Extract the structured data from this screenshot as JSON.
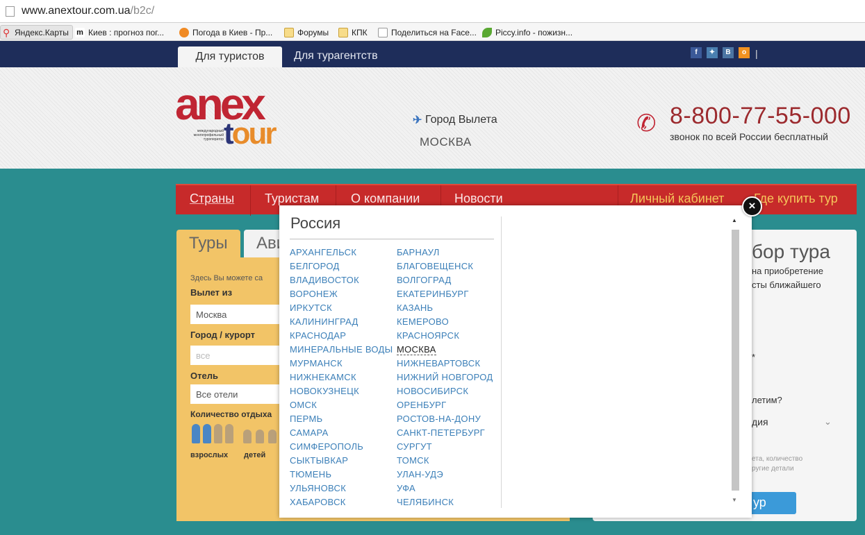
{
  "browser": {
    "url_host": "www.anextour.com.ua",
    "url_path": "/b2c/",
    "bookmarks": [
      {
        "label": "Яндекс.Карты",
        "icon": "yandex-maps-icon"
      },
      {
        "label": "Киев : прогноз пог...",
        "icon": "meteo-icon"
      },
      {
        "label": "Погода в Киев - Пр...",
        "icon": "weather-icon"
      },
      {
        "label": "Форумы",
        "icon": "folder-icon"
      },
      {
        "label": "КПК",
        "icon": "folder-icon"
      },
      {
        "label": "Поделиться на Face...",
        "icon": "page-icon"
      },
      {
        "label": "Piccy.info - пожизн...",
        "icon": "leaf-icon"
      }
    ]
  },
  "topnav": {
    "tab_tourists": "Для туристов",
    "tab_agents": "Для турагентств",
    "social": [
      "f",
      "✦",
      "В",
      "о"
    ],
    "separator": "|"
  },
  "header": {
    "logo_main": "anex",
    "logo_sub_a": "t",
    "logo_sub_b": "our",
    "logo_tagline": "международный многопрофильный туроператор",
    "city_label": "Город Вылета",
    "city_value": "МОСКВА",
    "phone": "8-800-77-55-000",
    "phone_note": "звонок по всей России бесплатный"
  },
  "menu": {
    "items": [
      "Страны",
      "Туристам",
      "О компании",
      "Новости"
    ],
    "cabinet": "Личный кабинет",
    "where_buy": "Где купить тур"
  },
  "left_panel": {
    "tab_tours": "Туры",
    "tab_avia": "Ави",
    "intro": "Здесь Вы можете са",
    "from_label": "Вылет из",
    "from_value": "Москва",
    "city_label": "Город / курорт",
    "city_value": "все",
    "hotel_label": "Отель",
    "hotel_value": "Все отели",
    "count_label": "Количество отдыха",
    "adults_label": "взрослых",
    "children_label": "детей"
  },
  "right_panel": {
    "title": "бор тура",
    "line1": "на приобретение",
    "line2": "сты ближайшего",
    "star": "*",
    "question": "летим?",
    "select_value": "дия",
    "note1": "ета, количество",
    "note2": "ругие детали",
    "button": "ур"
  },
  "overlay": {
    "country": "Россия",
    "selected_city": "МОСКВА",
    "cities_left": [
      "АРХАНГЕЛЬСК",
      "БЕЛГОРОД",
      "ВЛАДИВОСТОК",
      "ВОРОНЕЖ",
      "ИРКУТСК",
      "КАЛИНИНГРАД",
      "КРАСНОДАР",
      "МИНЕРАЛЬНЫЕ ВОДЫ",
      "МУРМАНСК",
      "НИЖНЕКАМСК",
      "НОВОКУЗНЕЦК",
      "ОМСК",
      "ПЕРМЬ",
      "САМАРА",
      "СИМФЕРОПОЛЬ",
      "СЫКТЫВКАР",
      "ТЮМЕНЬ",
      "УЛЬЯНОВСК",
      "ХАБАРОВСК"
    ],
    "cities_right": [
      "БАРНАУЛ",
      "БЛАГОВЕЩЕНСК",
      "ВОЛГОГРАД",
      "ЕКАТЕРИНБУРГ",
      "КАЗАНЬ",
      "КЕМЕРОВО",
      "КРАСНОЯРСК",
      "МОСКВА",
      "НИЖНЕВАРТОВСК",
      "НИЖНИЙ НОВГОРОД",
      "НОВОСИБИРСК",
      "ОРЕНБУРГ",
      "РОСТОВ-НА-ДОНУ",
      "САНКТ-ПЕТЕРБУРГ",
      "СУРГУТ",
      "ТОМСК",
      "УЛАН-УДЭ",
      "УФА",
      "ЧЕЛЯБИНСК"
    ],
    "close": "×",
    "scroll_up": "▲",
    "scroll_down": "▼"
  },
  "colors": {
    "brand_red": "#c02533",
    "nav_dark": "#1e2d5a",
    "link_blue": "#3b7fb8",
    "panel_yellow": "#f2c467",
    "background_teal": "#2a8d8f"
  }
}
